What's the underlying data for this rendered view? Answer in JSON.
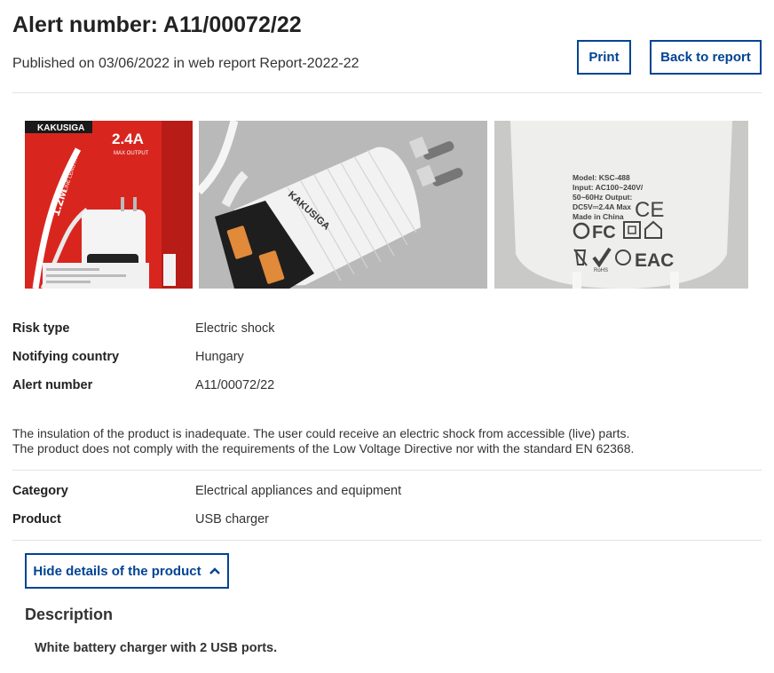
{
  "header": {
    "title": "Alert number: A11/00072/22",
    "published": "Published on 03/06/2022 in web report Report-2022-22",
    "print_label": "Print",
    "back_label": "Back to report"
  },
  "photos": {
    "box": {
      "brand": "KAKUSIGA",
      "amp": "2.4A",
      "amp_sub": "MAX OUTPUT",
      "cable": "1.2M",
      "cable_sub": "LINE LENGTH"
    },
    "charger": {
      "brand": "KAKUSIGA"
    },
    "label": {
      "lines": [
        "Model: KSC-488",
        "Input: AC100~240V/",
        "50~60Hz Output:",
        "DC5V⎓2.4A Max",
        "Made in China"
      ],
      "ce": "CE",
      "fc": "FC",
      "eac": "EAC",
      "rohs": "RoHS"
    }
  },
  "details": [
    {
      "label": "Risk type",
      "value": "Electric shock"
    },
    {
      "label": "Notifying country",
      "value": "Hungary"
    },
    {
      "label": "Alert number",
      "value": "A11/00072/22"
    }
  ],
  "risk_text": {
    "line1": "The insulation of the product is inadequate. The user could receive an electric shock from accessible (live) parts.",
    "line2": "The product does not comply with the requirements of the Low Voltage Directive nor with the standard EN 62368."
  },
  "classification": [
    {
      "label": "Category",
      "value": "Electrical appliances and equipment"
    },
    {
      "label": "Product",
      "value": "USB charger"
    }
  ],
  "product_toggle": {
    "label": "Hide details of the product",
    "icon": "chevron-up-icon"
  },
  "description": {
    "heading": "Description",
    "text": "White battery charger with 2 USB ports."
  },
  "colors": {
    "accent": "#004494",
    "box_red": "#d8261f"
  }
}
